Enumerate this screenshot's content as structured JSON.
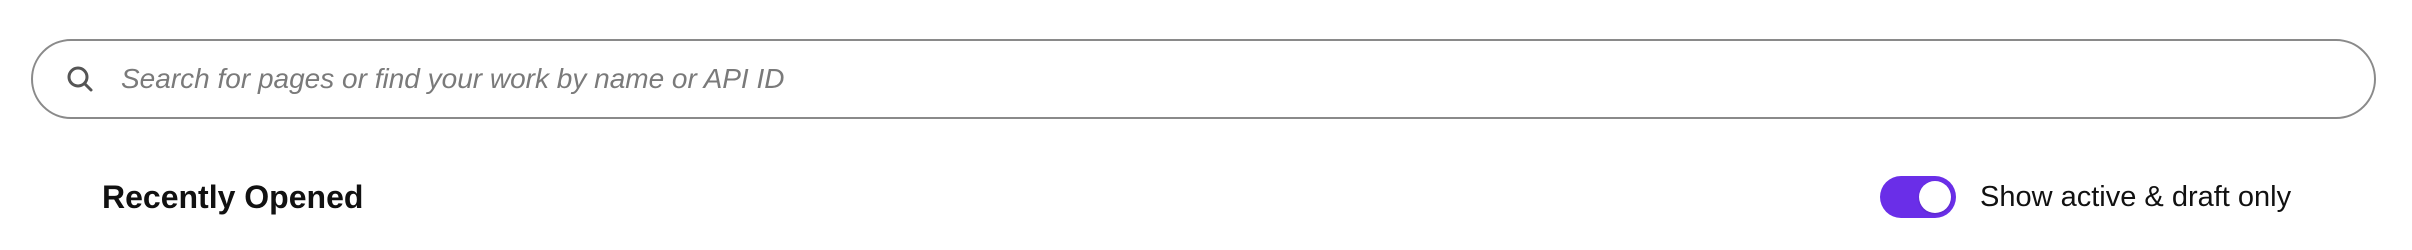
{
  "search": {
    "placeholder": "Search for pages or find your work by name or API ID",
    "value": "",
    "icon": "search-icon"
  },
  "recently_opened": {
    "title": "Recently Opened"
  },
  "filter": {
    "label": "Show active & draft only",
    "enabled": true,
    "accent_color": "#6a2ee8"
  }
}
